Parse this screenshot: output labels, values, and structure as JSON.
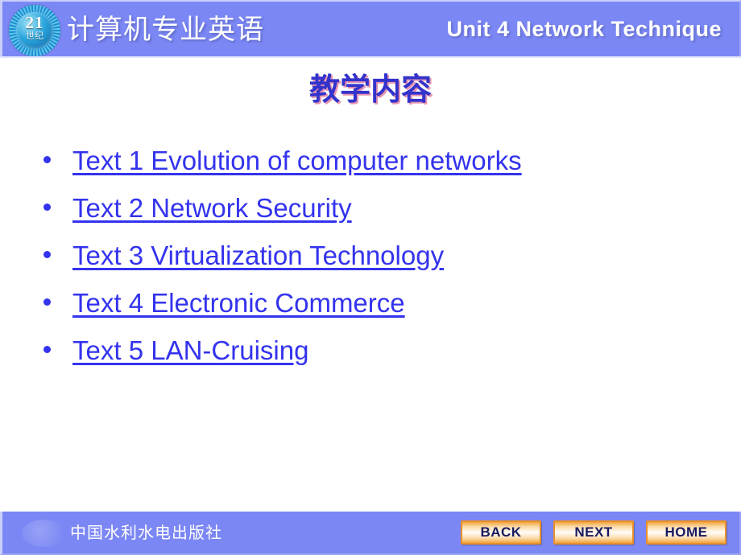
{
  "header": {
    "logo": {
      "number": "21",
      "label_cn": "世纪",
      "name": "21st-century-badge"
    },
    "course_title_cn": "计算机专业英语",
    "unit_title": "Unit 4  Network Technique"
  },
  "main": {
    "slide_title": "教学内容",
    "items": [
      {
        "label": "Text 1  Evolution of computer networks"
      },
      {
        "label": "Text 2  Network Security"
      },
      {
        "label": "Text 3  Virtualization Technology"
      },
      {
        "label": "Text 4  Electronic Commerce"
      },
      {
        "label": "Text 5  LAN-Cruising"
      }
    ]
  },
  "footer": {
    "publisher": "中国水利水电出版社",
    "buttons": [
      {
        "label": "BACK",
        "name": "back-button"
      },
      {
        "label": "NEXT",
        "name": "next-button"
      },
      {
        "label": "HOME",
        "name": "home-button"
      }
    ]
  },
  "colors": {
    "header_bg": "#7b87f4",
    "footer_bg": "#7b87f4",
    "link_blue": "#3333ee",
    "title_blue": "#3333cc",
    "title_shadow": "#d23c6e",
    "button_orange": "#f3a43c",
    "button_text": "#1a1a5e"
  }
}
